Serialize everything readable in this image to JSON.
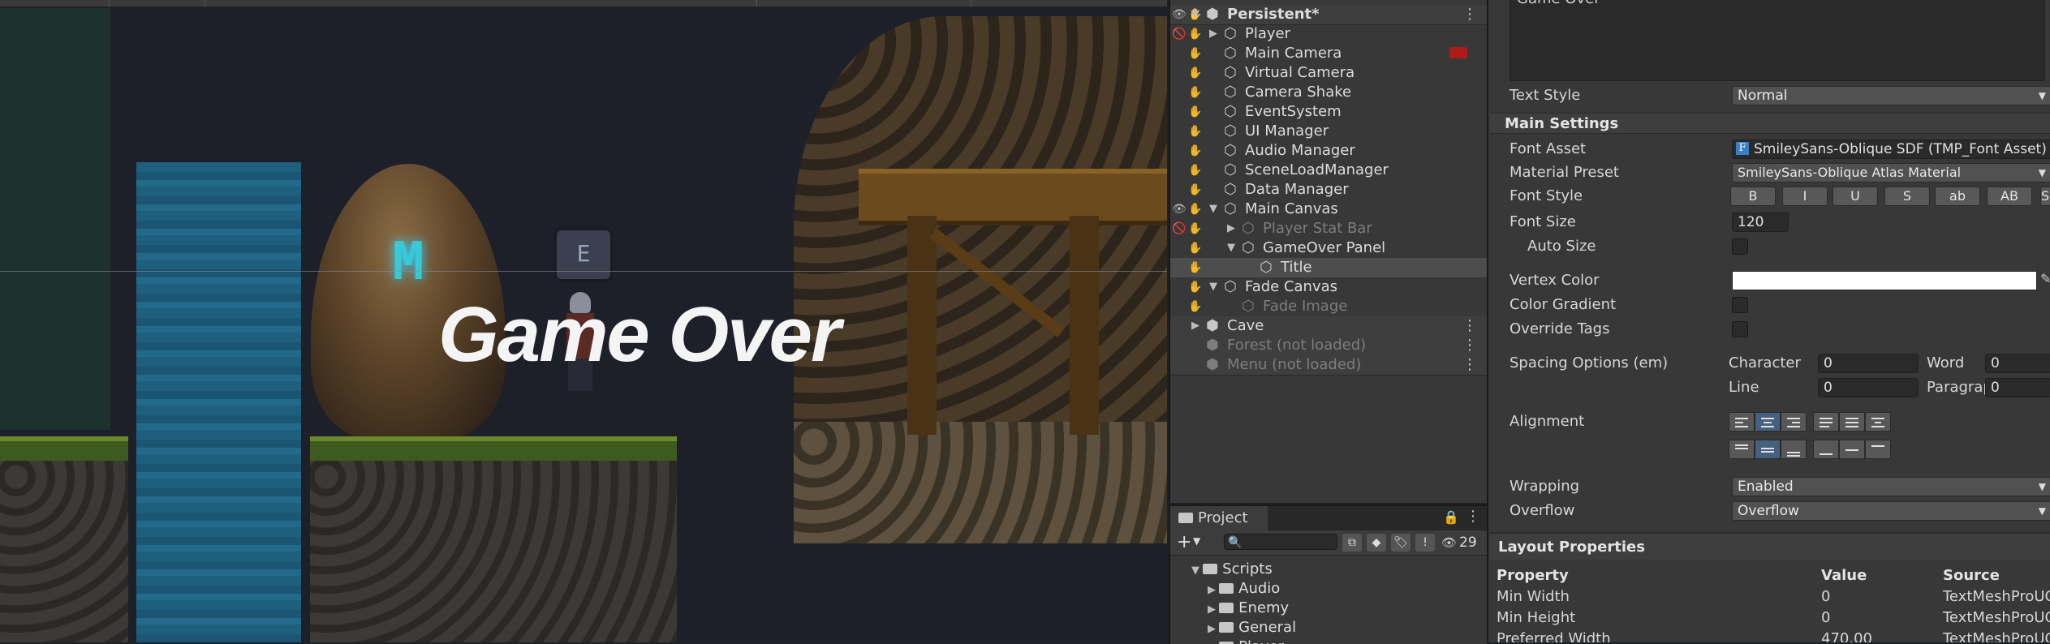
{
  "scene": {
    "overlay_text": "Game Over",
    "key_prompt": "E",
    "rune_glyph": "M"
  },
  "hierarchy": {
    "items": [
      {
        "label": "Persistent*",
        "type": "scene",
        "arrow": "▼",
        "icon": "unity-scene-icon",
        "menu": true,
        "bold": true
      },
      {
        "label": "Player",
        "arrow": "▶",
        "icon": "gameobject-icon"
      },
      {
        "label": "Main Camera",
        "icon": "gameobject-icon"
      },
      {
        "label": "Virtual Camera",
        "icon": "gameobject-icon"
      },
      {
        "label": "Camera Shake",
        "icon": "gameobject-icon"
      },
      {
        "label": "EventSystem",
        "icon": "gameobject-icon"
      },
      {
        "label": "UI Manager",
        "icon": "gameobject-icon"
      },
      {
        "label": "Audio Manager",
        "icon": "gameobject-icon"
      },
      {
        "label": "SceneLoadManager",
        "icon": "gameobject-icon"
      },
      {
        "label": "Data Manager",
        "icon": "gameobject-icon"
      },
      {
        "label": "Main Canvas",
        "arrow": "▼",
        "icon": "gameobject-icon"
      },
      {
        "label": "Player Stat Bar",
        "arrow": "▶",
        "icon": "gameobject-icon",
        "dim": true
      },
      {
        "label": "GameOver Panel",
        "arrow": "▼",
        "icon": "gameobject-icon"
      },
      {
        "label": "Title",
        "icon": "gameobject-icon",
        "selected": true
      },
      {
        "label": "Fade Canvas",
        "arrow": "▼",
        "icon": "gameobject-icon"
      },
      {
        "label": "Fade Image",
        "icon": "gameobject-icon",
        "dim": true
      },
      {
        "label": "Cave",
        "type": "scene",
        "arrow": "▶",
        "icon": "unity-scene-icon",
        "menu": true
      },
      {
        "label": "Forest (not loaded)",
        "type": "scene",
        "icon": "unity-scene-icon",
        "menu": true,
        "dim": true
      },
      {
        "label": "Menu (not loaded)",
        "type": "scene",
        "icon": "unity-scene-icon",
        "menu": true,
        "dim": true
      }
    ]
  },
  "project": {
    "tab_label": "Project",
    "add_label": "+",
    "hidden_count": "29",
    "tree": [
      {
        "label": "Scripts",
        "arrow": "▼"
      },
      {
        "label": "Audio",
        "arrow": "▶"
      },
      {
        "label": "Enemy",
        "arrow": "▶"
      },
      {
        "label": "General",
        "arrow": "▶"
      },
      {
        "label": "Player",
        "arrow": "▶"
      }
    ]
  },
  "inspector": {
    "text_input_value": "Game Over",
    "text_style_label": "Text Style",
    "text_style_value": "Normal",
    "main_settings_label": "Main Settings",
    "font_asset_label": "Font Asset",
    "font_asset_value": "SmileySans-Oblique SDF (TMP_Font Asset)",
    "material_preset_label": "Material Preset",
    "material_preset_value": "SmileySans-Oblique Atlas Material",
    "font_style_label": "Font Style",
    "font_style_buttons": [
      "B",
      "I",
      "U",
      "S",
      "ab",
      "AB",
      "SC"
    ],
    "font_size_label": "Font Size",
    "font_size_value": "120",
    "auto_size_label": "Auto Size",
    "vertex_color_label": "Vertex Color",
    "vertex_color": "#ffffff",
    "color_gradient_label": "Color Gradient",
    "override_tags_label": "Override Tags",
    "spacing_label": "Spacing Options (em)",
    "character_label": "Character",
    "character_value": "0",
    "word_label": "Word",
    "word_value": "0",
    "line_label": "Line",
    "line_value": "0",
    "paragraph_label": "Paragraph",
    "paragraph_value": "0",
    "alignment_label": "Alignment",
    "wrapping_label": "Wrapping",
    "wrapping_value": "Enabled",
    "overflow_label": "Overflow",
    "overflow_value": "Overflow",
    "layout_properties_label": "Layout Properties",
    "layout_table": {
      "headers": [
        "Property",
        "Value",
        "Source"
      ],
      "rows": [
        [
          "Min Width",
          "0",
          "TextMeshProUGUI"
        ],
        [
          "Min Height",
          "0",
          "TextMeshProUGUI"
        ],
        [
          "Preferred Width",
          "470.00",
          "TextMeshProUGUI"
        ]
      ]
    }
  }
}
